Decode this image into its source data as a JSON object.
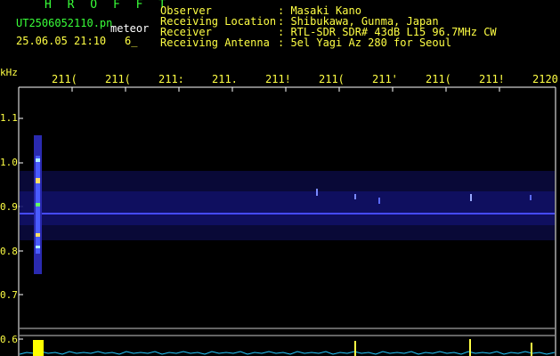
{
  "header": {
    "logo": "H R O F F T",
    "file_name": "UT2506052110.pn",
    "object": "meteor",
    "timestamp": "25.06.05 21:10",
    "count": "6_"
  },
  "metadata": [
    {
      "label": "Observer",
      "value": ": Masaki Kano"
    },
    {
      "label": "Receiving Location",
      "value": ": Shibukawa, Gunma, Japan"
    },
    {
      "label": "Receiver",
      "value": ": RTL-SDR SDR# 43dB L15 96.7MHz CW"
    },
    {
      "label": "Receiving Antenna",
      "value": ": 5el Yagi Az 280 for Seoul"
    }
  ],
  "axes": {
    "freq_unit": "kHz",
    "freq_ticks": [
      "1.1",
      "1.0",
      "0.9",
      "0.8",
      "0.7",
      "0.6"
    ],
    "time_ticks": [
      "211(",
      "211(",
      "211:",
      "211.",
      "211!",
      "211(",
      "211'",
      "211(",
      "211!",
      "2120"
    ]
  },
  "colors": {
    "background": "#000000",
    "label_yellow": "#ffff44",
    "logo_green": "#39ff39",
    "signal_blue": "#3a3aff",
    "trace_cyan": "#22c8ff"
  }
}
